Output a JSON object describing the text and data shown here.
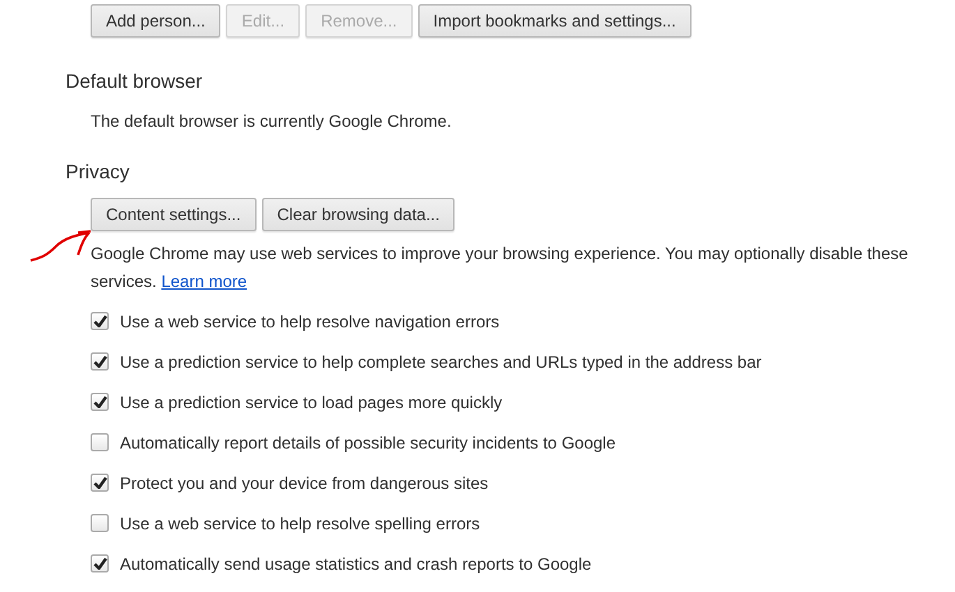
{
  "people_buttons": [
    {
      "label": "Add person...",
      "disabled": false
    },
    {
      "label": "Edit...",
      "disabled": true
    },
    {
      "label": "Remove...",
      "disabled": true
    },
    {
      "label": "Import bookmarks and settings...",
      "disabled": false
    }
  ],
  "default_browser": {
    "heading": "Default browser",
    "text": "The default browser is currently Google Chrome."
  },
  "privacy": {
    "heading": "Privacy",
    "buttons": [
      {
        "label": "Content settings...",
        "disabled": false
      },
      {
        "label": "Clear browsing data...",
        "disabled": false
      }
    ],
    "description": "Google Chrome may use web services to improve your browsing experience. You may optionally disable these services.",
    "link": "Learn more",
    "options": [
      {
        "label": "Use a web service to help resolve navigation errors",
        "checked": true
      },
      {
        "label": "Use a prediction service to help complete searches and URLs typed in the address bar",
        "checked": true
      },
      {
        "label": "Use a prediction service to load pages more quickly",
        "checked": true
      },
      {
        "label": "Automatically report details of possible security incidents to Google",
        "checked": false
      },
      {
        "label": "Protect you and your device from dangerous sites",
        "checked": true
      },
      {
        "label": "Use a web service to help resolve spelling errors",
        "checked": false
      },
      {
        "label": "Automatically send usage statistics and crash reports to Google",
        "checked": true
      }
    ]
  }
}
